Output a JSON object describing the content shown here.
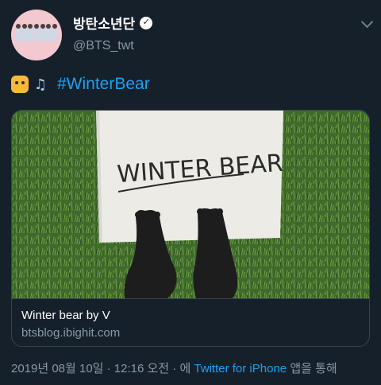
{
  "author": {
    "display_name": "방탄소년단",
    "handle": "@BTS_twt",
    "verified_icon": "✓"
  },
  "tweet": {
    "emoji": [
      "tiger-face",
      "headphone-music"
    ],
    "note_glyph": "♫",
    "hashtag": "#WinterBear"
  },
  "card": {
    "image_text": "WINTER BEAR",
    "title": "Winter bear by V",
    "domain": "btsblog.ibighit.com"
  },
  "meta": {
    "timestamp": "2019년 08월 10일 · 12:16 오전 · 에",
    "source": "Twitter for iPhone",
    "suffix": "앱을 통해"
  },
  "colors": {
    "background": "#15202b",
    "link": "#1da1f2",
    "muted": "#8899a6",
    "border": "#38444d"
  }
}
